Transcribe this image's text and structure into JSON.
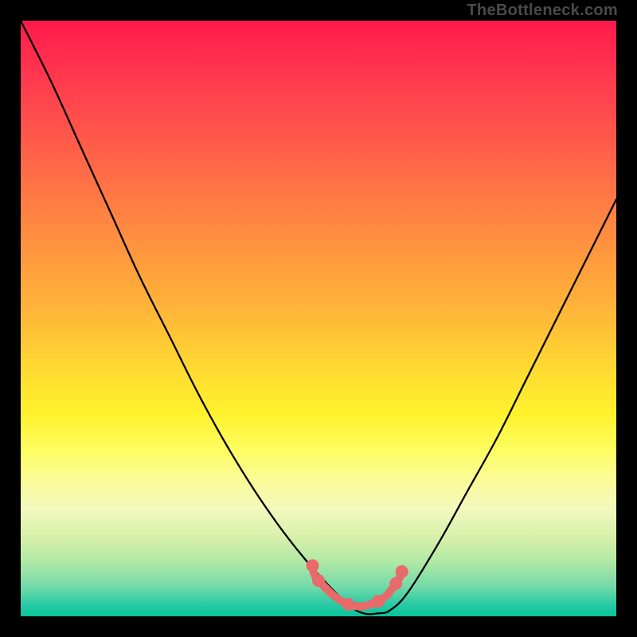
{
  "watermark": "TheBottleneck.com",
  "chart_data": {
    "type": "line",
    "title": "",
    "xlabel": "",
    "ylabel": "",
    "xlim": [
      0,
      1
    ],
    "ylim": [
      0,
      1
    ],
    "grid": false,
    "legend": false,
    "background_gradient": [
      "#ff1a4b",
      "#ff9a3e",
      "#fff22c",
      "#06c49c"
    ],
    "series": [
      {
        "name": "curve",
        "color": "#000000",
        "x": [
          0.0,
          0.05,
          0.1,
          0.15,
          0.2,
          0.25,
          0.3,
          0.35,
          0.4,
          0.45,
          0.5,
          0.55,
          0.576,
          0.6,
          0.62,
          0.65,
          0.7,
          0.75,
          0.8,
          0.85,
          0.9,
          0.95,
          1.0
        ],
        "y": [
          1.0,
          0.9,
          0.79,
          0.68,
          0.57,
          0.47,
          0.37,
          0.28,
          0.2,
          0.13,
          0.07,
          0.02,
          0.005,
          0.005,
          0.01,
          0.04,
          0.12,
          0.21,
          0.3,
          0.4,
          0.5,
          0.6,
          0.7
        ]
      }
    ],
    "markers": {
      "name": "highlight-points",
      "color": "#e86a6a",
      "x": [
        0.49,
        0.5,
        0.55,
        0.6,
        0.63,
        0.64
      ],
      "y": [
        0.085,
        0.06,
        0.02,
        0.025,
        0.055,
        0.075
      ]
    }
  }
}
